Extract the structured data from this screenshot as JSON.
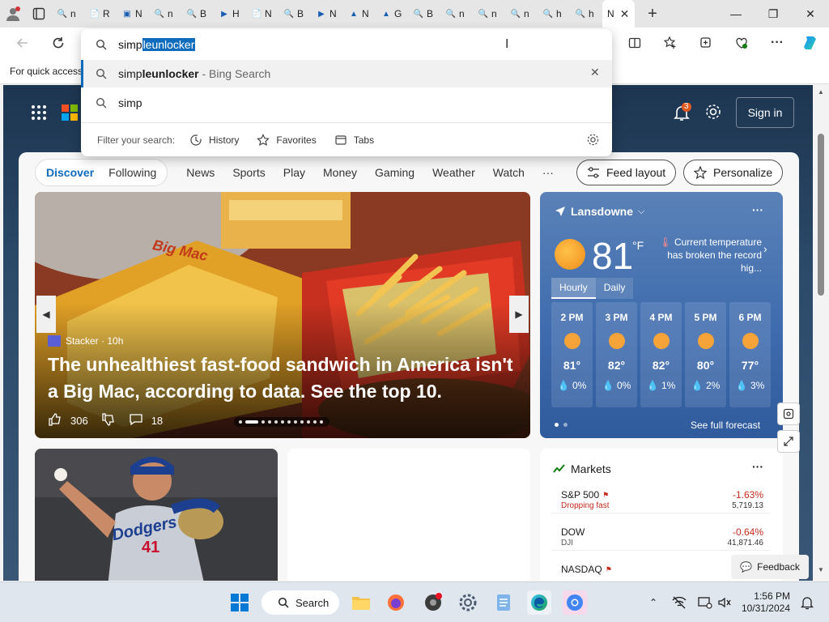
{
  "tabs": {
    "items": [
      "n",
      "R",
      "N",
      "n",
      "B",
      "H",
      "N",
      "B",
      "N",
      "N",
      "G",
      "B",
      "n",
      "n",
      "n",
      "h",
      "h"
    ],
    "active_label": "N",
    "close": "✕",
    "new_tab": "+"
  },
  "window": {
    "minimize": "—",
    "maximize": "❐",
    "close": "✕"
  },
  "favorites_bar": {
    "text": "For quick access"
  },
  "omnibox": {
    "typed": "simp",
    "selected": "leunlocker",
    "suggestions": [
      {
        "prefix": "simp",
        "bold": "leunlocker",
        "hint": " - Bing Search"
      },
      {
        "prefix": "simp",
        "bold": "",
        "hint": ""
      }
    ],
    "filter_label": "Filter your search:",
    "filters": [
      "History",
      "Favorites",
      "Tabs"
    ]
  },
  "header": {
    "sign_in": "Sign in",
    "notification_count": "3"
  },
  "nav": {
    "pill": [
      "Discover",
      "Following"
    ],
    "links": [
      "News",
      "Sports",
      "Play",
      "Money",
      "Gaming",
      "Weather",
      "Watch",
      "···"
    ],
    "feed_layout": "Feed layout",
    "personalize": "Personalize"
  },
  "hero": {
    "source": "Stacker · 10h",
    "title": "The unhealthiest fast-food sandwich in America isn't a Big Mac, according to data. See the top 10.",
    "likes": "306",
    "comments": "18",
    "image_text": "Big Mac"
  },
  "weather": {
    "location": "Lansdowne",
    "temp": "81",
    "unit": "°F",
    "alert": "Current temperature has broken the record hig...",
    "tabs": [
      "Hourly",
      "Daily"
    ],
    "hours": [
      {
        "time": "2 PM",
        "temp": "81°",
        "precip": "0%"
      },
      {
        "time": "3 PM",
        "temp": "82°",
        "precip": "0%"
      },
      {
        "time": "4 PM",
        "temp": "82°",
        "precip": "1%"
      },
      {
        "time": "5 PM",
        "temp": "80°",
        "precip": "2%"
      },
      {
        "time": "6 PM",
        "temp": "77°",
        "precip": "3%"
      }
    ],
    "forecast_link": "See full forecast"
  },
  "player_card": {
    "team": "Dodgers",
    "number": "41"
  },
  "markets": {
    "title": "Markets",
    "rows": [
      {
        "name": "S&P 500",
        "sub": "Dropping fast",
        "change": "-1.63%",
        "value": "5,719.13"
      },
      {
        "name": "DOW",
        "sub": "DJI",
        "change": "-0.64%",
        "value": "41,871.46"
      },
      {
        "name": "NASDAQ",
        "sub": "",
        "change": "",
        "value": ""
      }
    ]
  },
  "feedback": "Feedback",
  "taskbar": {
    "search": "Search",
    "time": "1:56 PM",
    "date": "10/31/2024"
  }
}
